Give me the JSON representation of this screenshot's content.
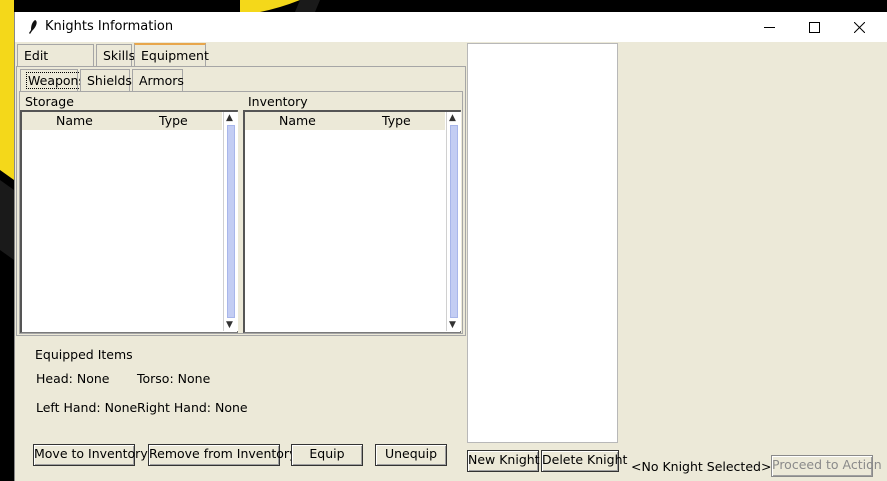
{
  "window": {
    "title": "Knights Information",
    "controls": {
      "minimize": "minimize-icon",
      "maximize": "maximize-icon",
      "close": "close-icon"
    }
  },
  "tabs": [
    "Edit Abilities",
    "Skills",
    "Equipment"
  ],
  "selected_tab": "Equipment",
  "subtabs": [
    "Weapons",
    "Shields",
    "Armors"
  ],
  "selected_subtab": "Weapons",
  "storage": {
    "label": "Storage",
    "columns": [
      "Name",
      "Type"
    ],
    "rows": []
  },
  "inventory": {
    "label": "Inventory",
    "columns": [
      "Name",
      "Type"
    ],
    "rows": []
  },
  "equipped": {
    "title": "Equipped Items",
    "head": "Head: None",
    "torso": "Torso: None",
    "left_hand": "Left Hand: None",
    "right_hand": "Right Hand: None"
  },
  "actions": {
    "move_to_inventory": "Move to Inventory",
    "remove_from_inventory": "Remove from Inventory",
    "equip": "Equip",
    "unequip": "Unequip"
  },
  "knights": {
    "items": [],
    "new_knight": "New Knight",
    "delete_knight": "Delete Knight",
    "status": "<No Knight Selected>",
    "proceed": "Proceed to Action"
  },
  "colors": {
    "tab_accent": "#e8a64b",
    "scroll_thumb": "#c3cdf3",
    "window_bg": "#ece9d8"
  }
}
